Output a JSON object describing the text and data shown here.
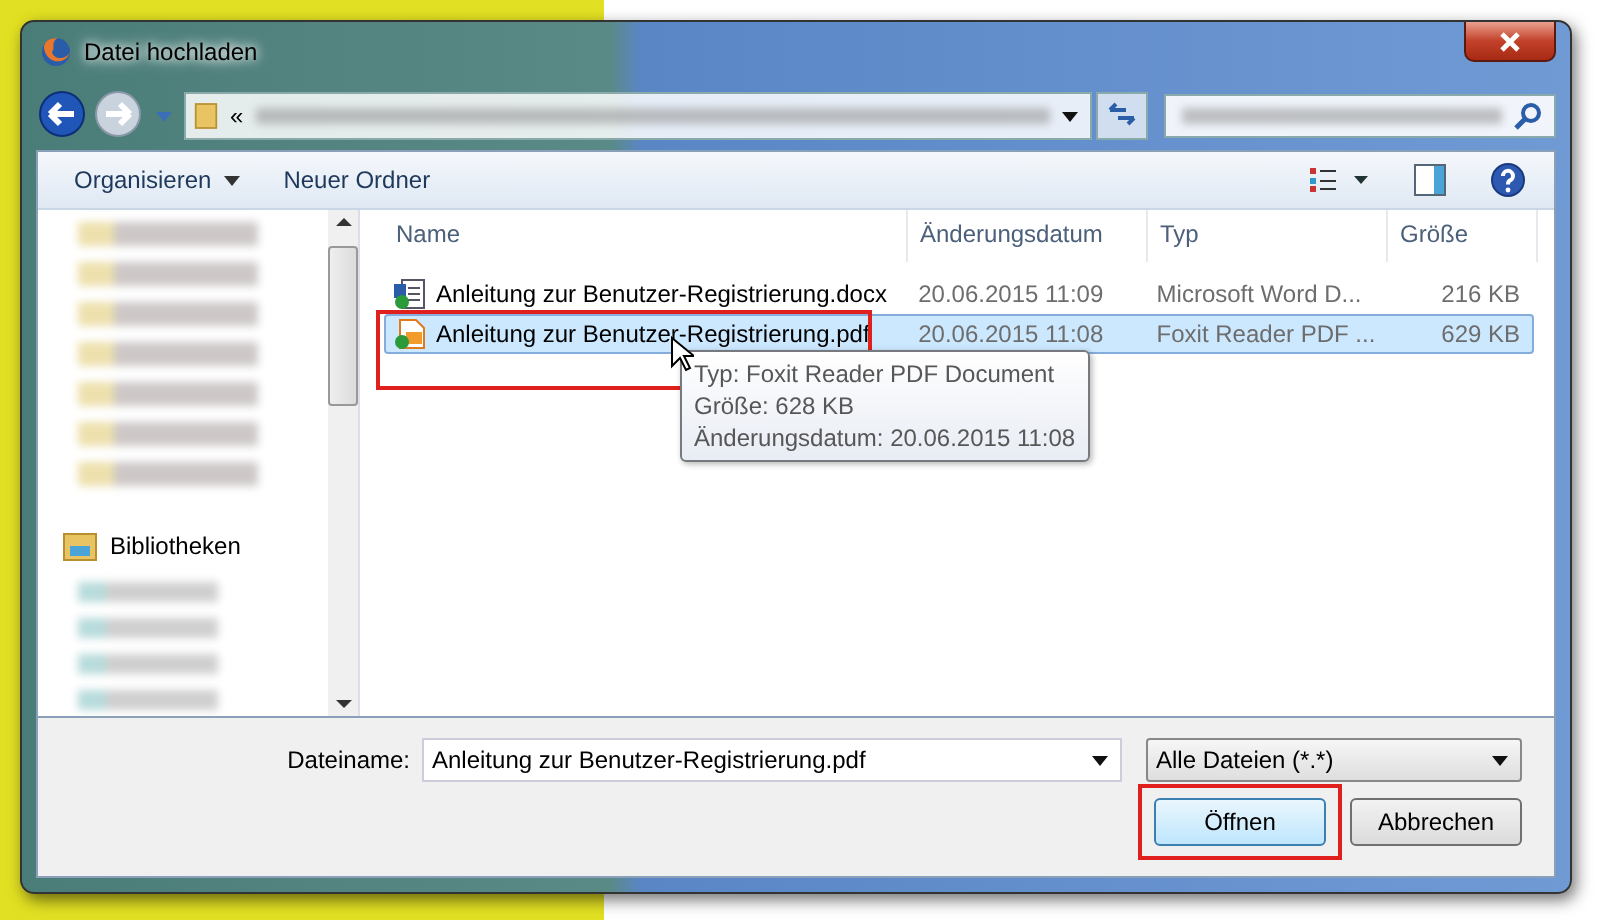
{
  "window": {
    "title": "Datei hochladen"
  },
  "address": {
    "prefix": "«"
  },
  "toolbar": {
    "organize": "Organisieren",
    "new_folder": "Neuer Ordner"
  },
  "sidebar": {
    "library_heading": "Bibliotheken"
  },
  "columns": [
    "Name",
    "Änderungsdatum",
    "Typ",
    "Größe"
  ],
  "files": [
    {
      "name": "Anleitung zur Benutzer-Registrierung.docx",
      "kind": "word",
      "date": "20.06.2015 11:09",
      "type": "Microsoft Word D...",
      "size": "216 KB",
      "selected": false,
      "highlighted": false
    },
    {
      "name": "Anleitung zur Benutzer-Registrierung.pdf",
      "kind": "pdf",
      "date": "20.06.2015 11:08",
      "type": "Foxit Reader PDF ...",
      "size": "629 KB",
      "selected": true,
      "highlighted": true
    }
  ],
  "tooltip": [
    "Typ: Foxit Reader PDF Document",
    "Größe: 628 KB",
    "Änderungsdatum: 20.06.2015 11:08"
  ],
  "filename": {
    "label": "Dateiname:",
    "value": "Anleitung zur Benutzer-Registrierung.pdf"
  },
  "filter": {
    "value": "Alle Dateien (*.*)"
  },
  "buttons": [
    {
      "label": "Öffnen",
      "default": true,
      "highlighted": true
    },
    {
      "label": "Abbrechen",
      "default": false,
      "highlighted": false
    }
  ]
}
